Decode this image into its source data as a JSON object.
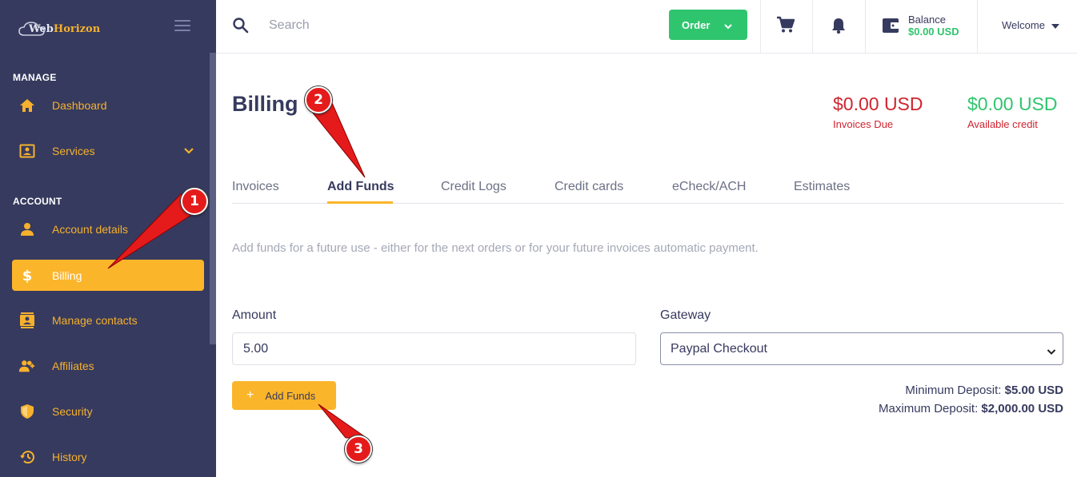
{
  "logo": {
    "part1": "Web",
    "part2": "Horizon"
  },
  "sidebar": {
    "manage_label": "MANAGE",
    "account_label": "ACCOUNT",
    "items": [
      {
        "label": "Dashboard",
        "icon": "home-icon"
      },
      {
        "label": "Services",
        "icon": "services-icon"
      },
      {
        "label": "Account details",
        "icon": "user-icon"
      },
      {
        "label": "Billing",
        "icon": "dollar-icon",
        "active": true
      },
      {
        "label": "Manage contacts",
        "icon": "contacts-icon"
      },
      {
        "label": "Affiliates",
        "icon": "affiliates-icon"
      },
      {
        "label": "Security",
        "icon": "shield-icon"
      },
      {
        "label": "History",
        "icon": "history-icon"
      }
    ]
  },
  "topbar": {
    "search_placeholder": "Search",
    "order_label": "Order",
    "balance_label": "Balance",
    "balance_value": "$0.00 USD",
    "welcome_label": "Welcome"
  },
  "page": {
    "title": "Billing",
    "invoices_due_value": "$0.00 USD",
    "invoices_due_label": "Invoices Due",
    "available_credit_value": "$0.00 USD",
    "available_credit_label": "Available credit"
  },
  "tabs": [
    "Invoices",
    "Add Funds",
    "Credit Logs",
    "Credit cards",
    "eCheck/ACH",
    "Estimates"
  ],
  "form": {
    "description": "Add funds for a future use - either for the next orders or for your future invoices automatic payment.",
    "amount_label": "Amount",
    "amount_value": "5.00",
    "gateway_label": "Gateway",
    "gateway_value": "Paypal Checkout",
    "submit_label": "Add Funds",
    "min_deposit_label": "Minimum Deposit:",
    "min_deposit_value": "$5.00 USD",
    "max_deposit_label": "Maximum Deposit:",
    "max_deposit_value": "$2,000.00 USD"
  },
  "annotations": [
    "1",
    "2",
    "3"
  ],
  "colors": {
    "sidebar_bg": "#363a5e",
    "accent": "#fbb52b",
    "green": "#2fc56e",
    "red": "#d0242f",
    "annotation_red": "#e51b1b"
  }
}
